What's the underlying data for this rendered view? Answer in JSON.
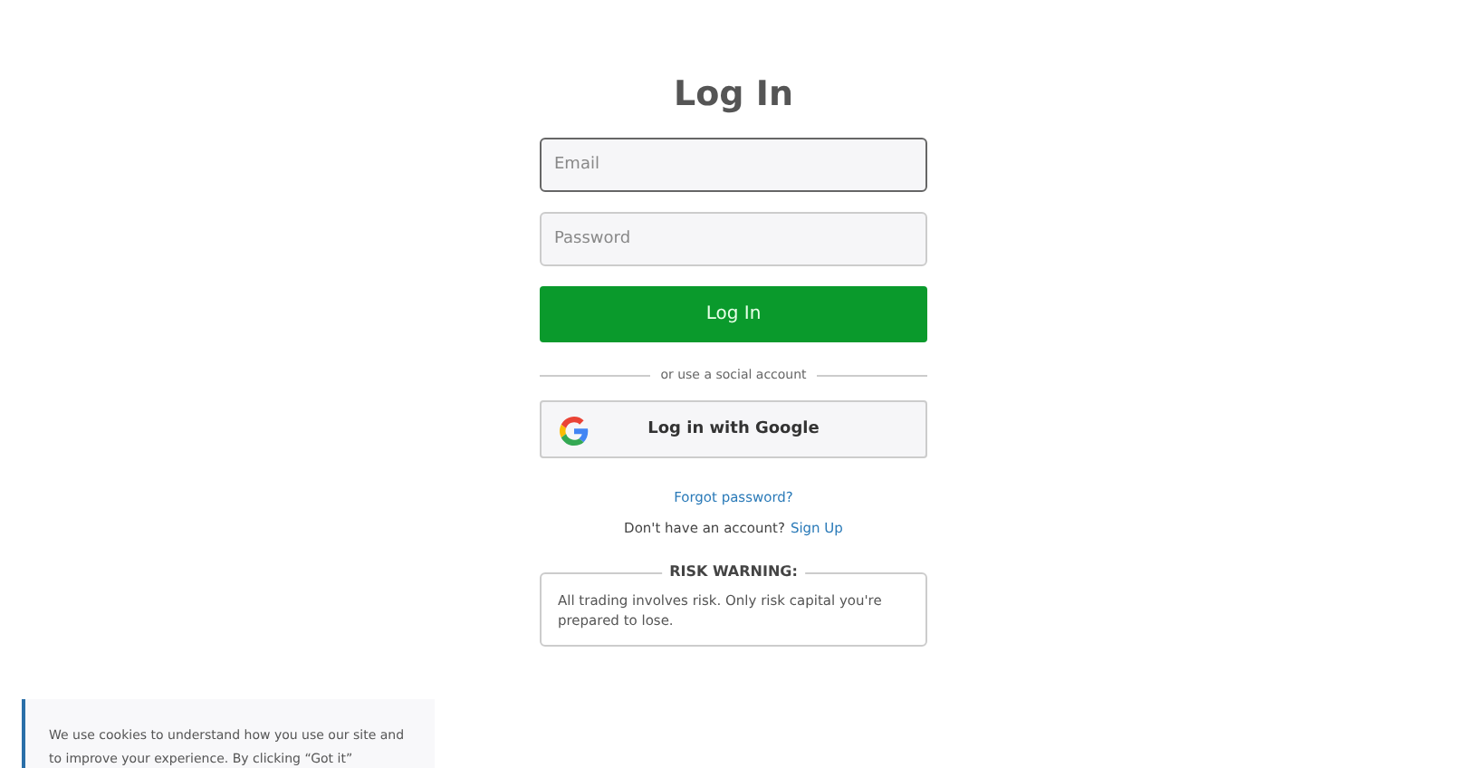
{
  "title": "Log In",
  "fields": [
    {
      "placeholder": "Email",
      "focused": true
    },
    {
      "placeholder": "Password",
      "focused": false
    }
  ],
  "submit": "Log In",
  "divider": "or use a social account",
  "social_button": "Log in with Google",
  "forgot": "Forgot password?",
  "signup": {
    "prompt": "Don't have an account?",
    "link": "Sign Up"
  },
  "risk": {
    "heading": "RISK WARNING:",
    "text": "All trading involves risk. Only risk capital you're prepared to lose."
  },
  "cookie_banner": {
    "text": "We use cookies to understand how you use our site and to improve your experience. By clicking “Got it”"
  }
}
